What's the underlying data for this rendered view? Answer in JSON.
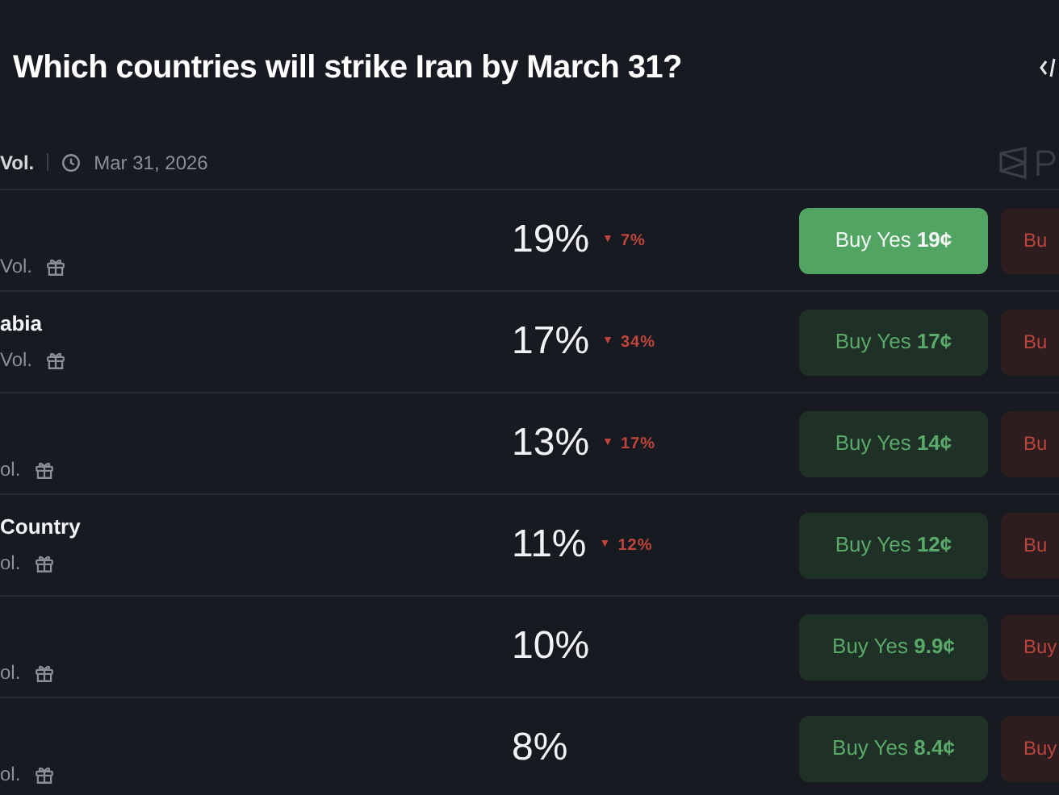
{
  "title": "Which countries will strike Iran by March 31?",
  "meta": {
    "volume": "Vol.",
    "end_date": "Mar 31, 2026"
  },
  "outcomes": [
    {
      "volume": "Vol.",
      "chance": "19%",
      "change": {
        "arrow": "▼",
        "text": "7%"
      },
      "buy_yes": {
        "label": "Buy Yes",
        "price": "19¢",
        "selected": true
      },
      "buy_no": "Bu"
    },
    {
      "name": "abia",
      "volume": "Vol.",
      "chance": "17%",
      "change": {
        "arrow": "▼",
        "text": "34%"
      },
      "buy_yes": {
        "label": "Buy Yes",
        "price": "17¢",
        "selected": false
      },
      "buy_no": "Bu"
    },
    {
      "volume": "ol.",
      "chance": "13%",
      "change": {
        "arrow": "▼",
        "text": "17%"
      },
      "buy_yes": {
        "label": "Buy Yes",
        "price": "14¢",
        "selected": false
      },
      "buy_no": "Bu"
    },
    {
      "name": "Country",
      "volume": "ol.",
      "chance": "11%",
      "change": {
        "arrow": "▼",
        "text": "12%"
      },
      "buy_yes": {
        "label": "Buy Yes",
        "price": "12¢",
        "selected": false
      },
      "buy_no": "Bu"
    },
    {
      "volume": "ol.",
      "chance": "10%",
      "buy_yes": {
        "label": "Buy Yes",
        "price": "9.9¢",
        "selected": false
      },
      "buy_no": "Buy"
    },
    {
      "volume": "ol.",
      "chance": "8%",
      "buy_yes": {
        "label": "Buy Yes",
        "price": "8.4¢",
        "selected": false
      },
      "buy_no": "Buy"
    }
  ]
}
